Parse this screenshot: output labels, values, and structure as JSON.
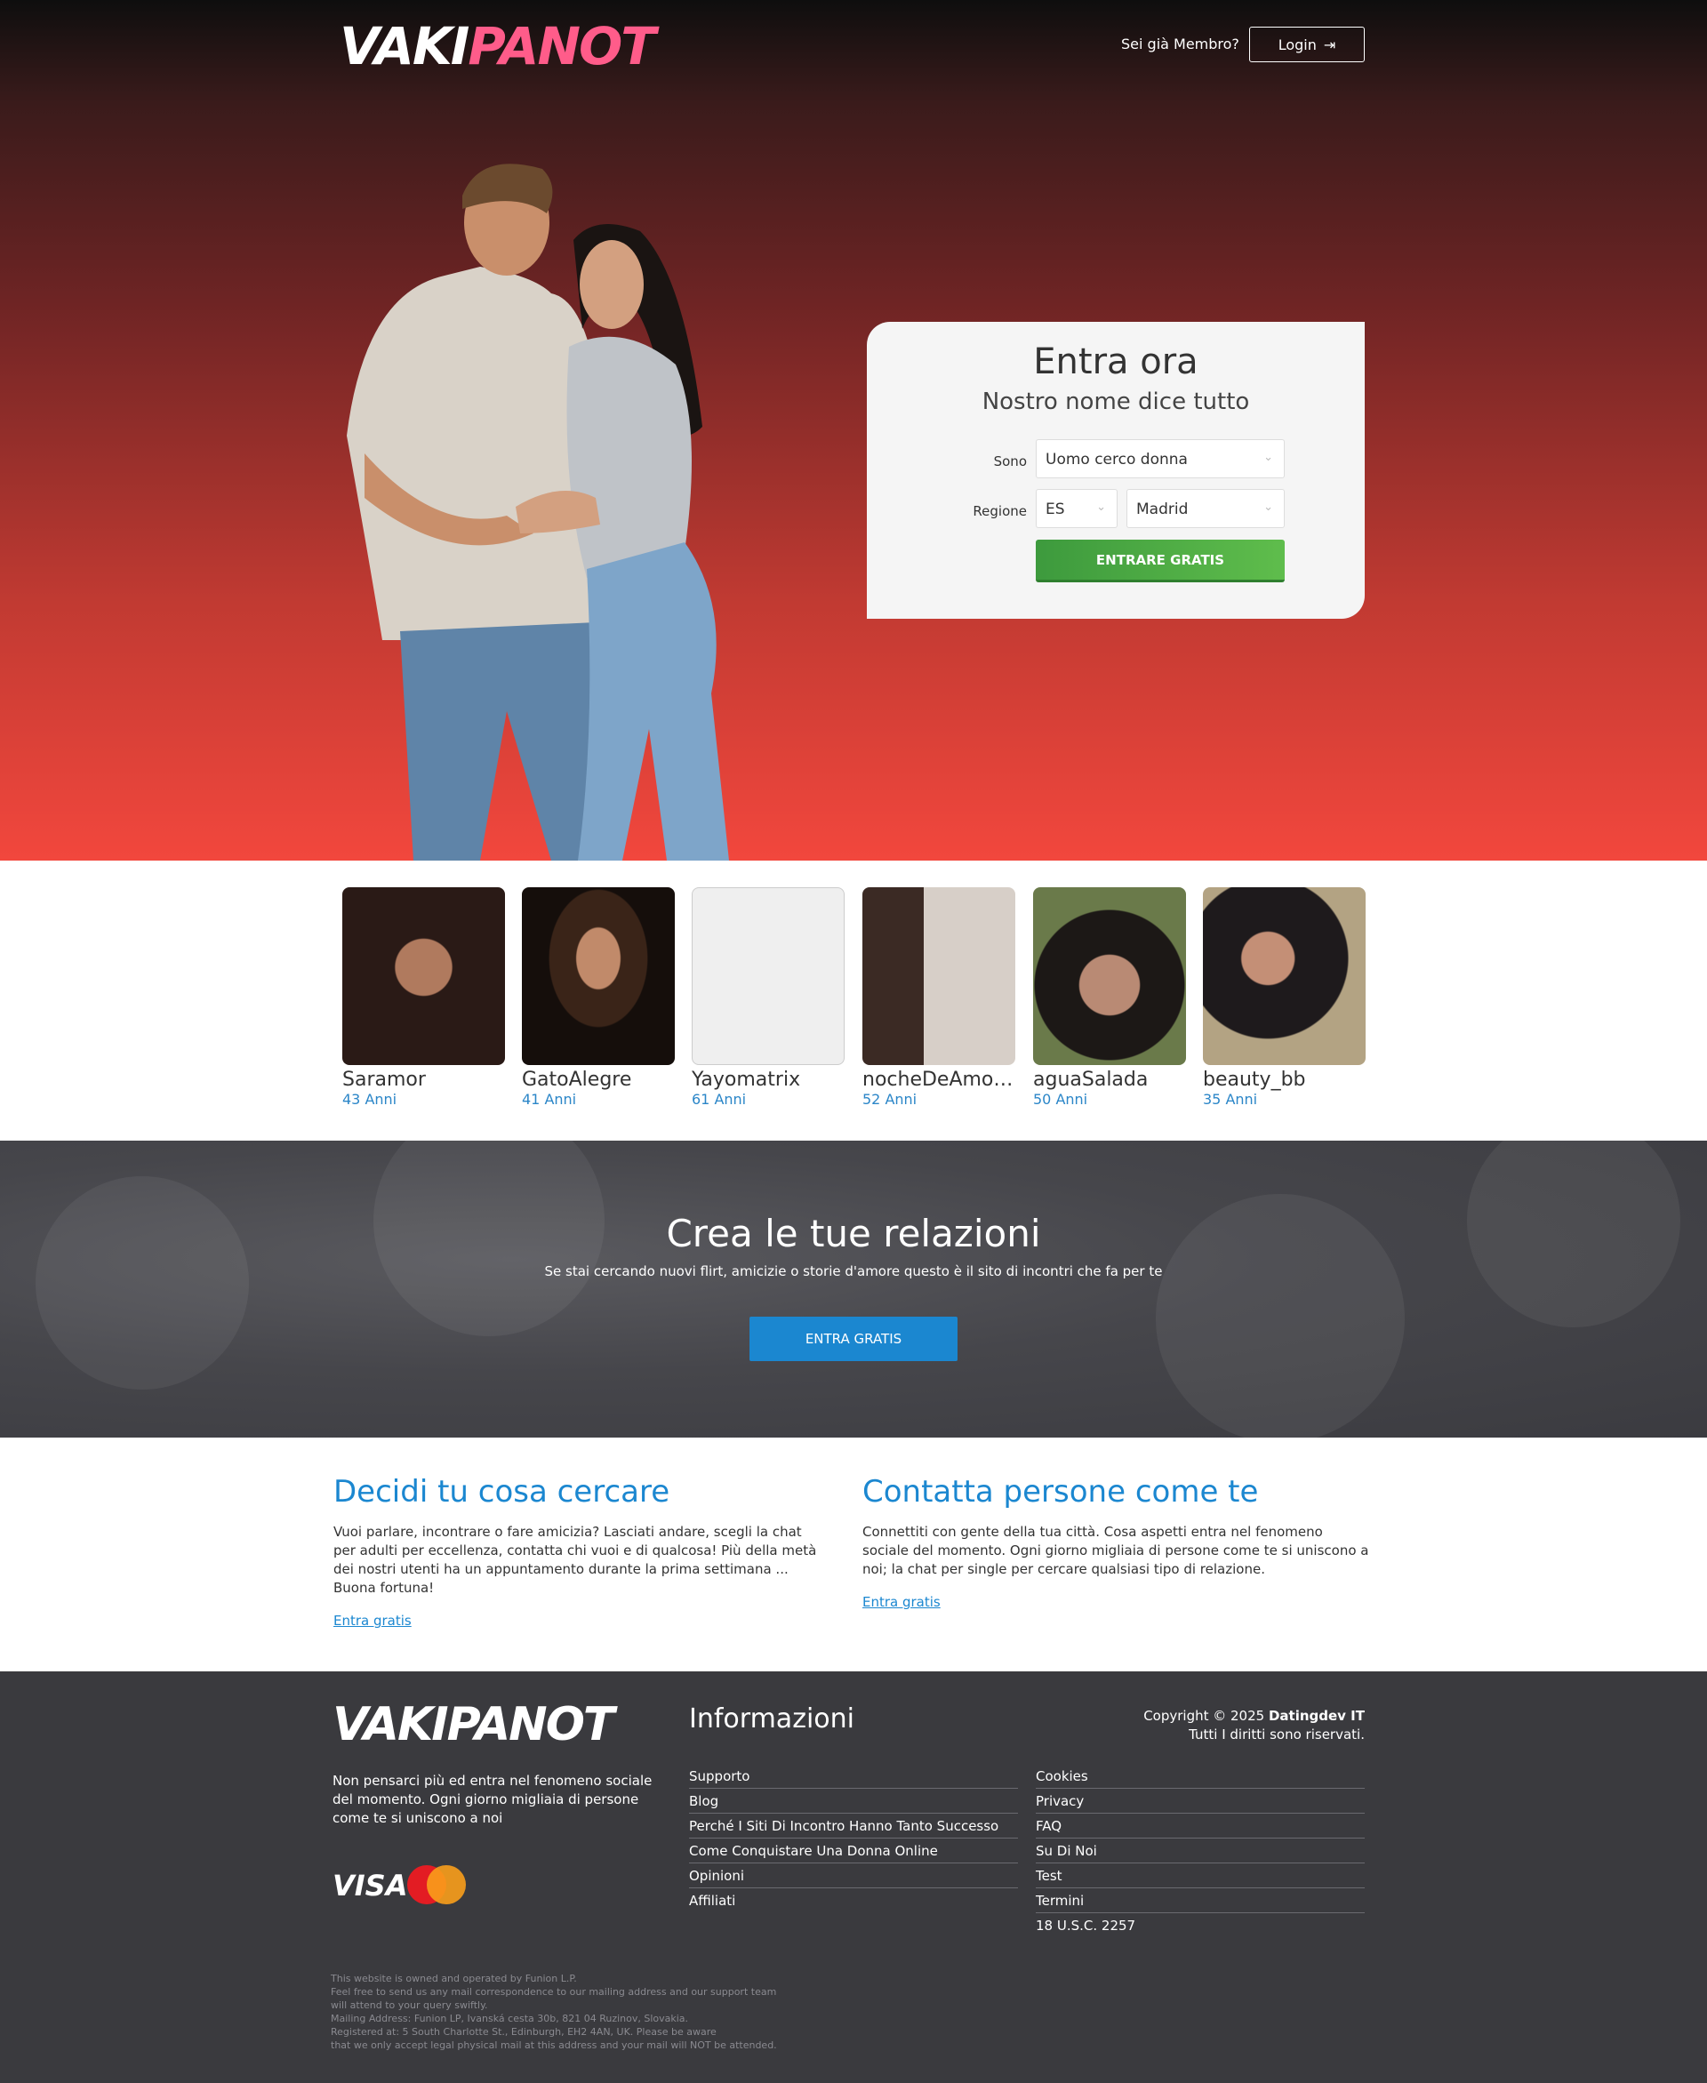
{
  "header": {
    "logo_white": "VAKI",
    "logo_pink": "PANOT",
    "member_question": "Sei già Membro?",
    "login_label": "Login"
  },
  "form": {
    "title": "Entra ora",
    "subtitle": "Nostro nome dice tutto",
    "sono_label": "Sono",
    "sono_value": "Uomo cerco donna",
    "regione_label": "Regione",
    "country_value": "ES",
    "region_value": "Madrid",
    "submit_label": "ENTRARE GRATIS"
  },
  "profiles": [
    {
      "name": "Saramor",
      "age": "43 Anni"
    },
    {
      "name": "GatoAlegre",
      "age": "41 Anni"
    },
    {
      "name": "Yayomatrix",
      "age": "61 Anni"
    },
    {
      "name": "nocheDeAmor...",
      "age": "52 Anni"
    },
    {
      "name": "aguaSalada",
      "age": "50 Anni"
    },
    {
      "name": "beauty_bb",
      "age": "35 Anni"
    }
  ],
  "banner": {
    "title": "Crea le tue relazioni",
    "text": "Se stai cercando nuovi flirt, amicizie o storie d'amore questo è il sito di incontri che fa per te",
    "cta": "ENTRA GRATIS"
  },
  "info": {
    "left": {
      "title": "Decidi tu cosa cercare",
      "text": "Vuoi parlare, incontrare o fare amicizia? Lasciati andare, scegli la chat per adulti per eccellenza, contatta chi vuoi e di qualcosa! Più della metà dei nostri utenti ha un appuntamento durante la prima settimana ... Buona fortuna!",
      "link": "Entra gratis"
    },
    "right": {
      "title": "Contatta persone come te",
      "text": "Connettiti con gente della tua città. Cosa aspetti entra nel fenomeno sociale del momento. Ogni giorno migliaia di persone come te si uniscono a noi; la chat per single per cercare qualsiasi tipo di relazione.",
      "link": "Entra gratis"
    }
  },
  "footer": {
    "logo": "VAKIPANOT",
    "tagline": "Non pensarci più ed entra nel fenomeno sociale del momento. Ogni giorno migliaia di persone come te si uniscono a noi",
    "visa": "VISA",
    "info_title": "Informazioni",
    "links_left": [
      "Supporto",
      "Blog",
      "Perché I Siti Di Incontro Hanno Tanto Successo",
      "Come Conquistare Una Donna Online",
      "Opinioni",
      "Affiliati"
    ],
    "links_right": [
      "Cookies",
      "Privacy",
      "FAQ",
      "Su Di Noi",
      "Test",
      "Termini",
      "18 U.S.C. 2257"
    ],
    "copyright_prefix": "Copyright © 2025 ",
    "copyright_company": "Datingdev IT",
    "rights": "Tutti I diritti sono riservati.",
    "legal": "This website is owned and operated by Funion L.P.\nFeel free to send us any mail correspondence to our mailing address and our support team\nwill attend to your query swiftly.\nMailing Address: Funion LP, Ivanská cesta 30b, 821 04 Ruzinov, Slovakia.\nRegistered at: 5 South Charlotte St., Edinburgh, EH2 4AN, UK. Please be aware\nthat we only accept legal physical mail at this address and your mail will NOT be attended."
  },
  "colors": {
    "accent_blue": "#1b87d0",
    "brand_pink": "#ff5c8a",
    "cta_green": "#4caf50",
    "hero_red": "#f2473d"
  }
}
